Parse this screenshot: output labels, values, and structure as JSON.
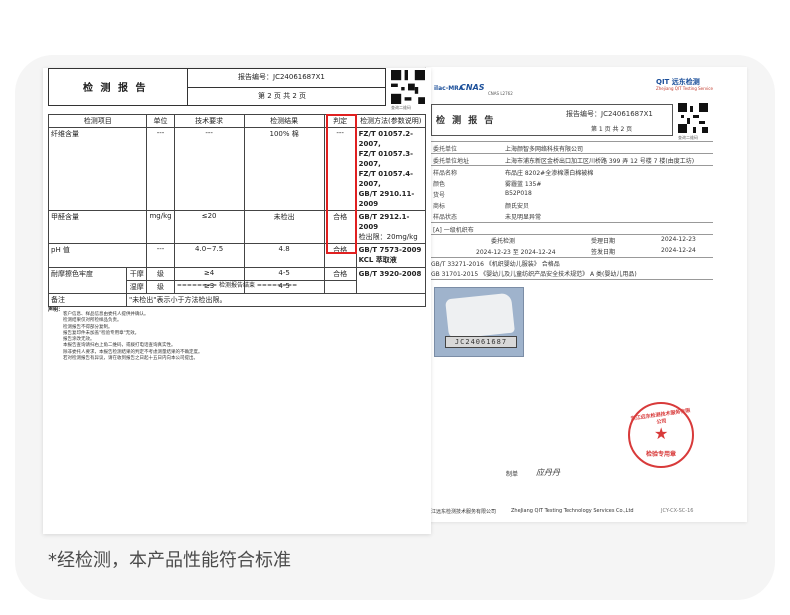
{
  "back": {
    "logo_ilac": "ilac-MRA",
    "logo_cnas": "CNAS",
    "cnas_number": "CNAS L2762",
    "brand": "QIT 远东检测",
    "brand_sub": "Zhejiang QIT Testing Service",
    "title": "检 测 报 告",
    "report_no": "报告编号：JC24061687X1",
    "page": "第 1 页 共 2 页",
    "qr_caption": "查询二维码",
    "rows": [
      {
        "label": "委托单位",
        "value": "上海颜智多网络科技有限公司"
      },
      {
        "label": "委托单位地址",
        "value": "上海市浦东新区金桥出口加工区川桥路 399 弄 12 号楼 7 楼(由度工坊)"
      },
      {
        "label": "样品名称",
        "value": "布品庄 8202#全渗棉漂白棉被棉"
      },
      {
        "label": "颜色",
        "value": "雾霾蓝 135#"
      },
      {
        "label": "货号",
        "value": "B52P018"
      },
      {
        "label": "商标",
        "value": "颜氏安贝"
      },
      {
        "label": "样品状态",
        "value": "未见明显异常"
      }
    ],
    "category": "[A] 一级机织布",
    "date_head_left": "委托检测",
    "date_head_mid": "受理日期",
    "date_head_right": "2024-12-23",
    "date_range": "2024-12-23 至 2024-12-24",
    "date_done_label": "签发日期",
    "date_done": "2024-12-24",
    "standards": [
      "GB/T 33271-2016 《机织婴幼儿服装》 合格品",
      "GB 31701-2015 《婴幼儿及儿童纺织产品安全技术规范》 A 类(婴幼儿用品)"
    ],
    "sample_tag": "JC24061687",
    "stamp_top": "浙江远东检测技术服务有限公司",
    "stamp_bottom": "检验专用章",
    "sign_label": "制单",
    "sign_name": "应丹丹",
    "footer_cn": "浙江远东检测技术服务有限公司",
    "footer_en": "ZheJiang QIT Testing Technology Services Co.,Ltd",
    "footer_tail": "JCY-CX-SC-16"
  },
  "front": {
    "title": "检 测 报 告",
    "report_no": "报告编号：JC24061687X1",
    "page": "第 2 页 共 2 页",
    "qr_caption": "查询二维码",
    "headers": [
      "检测项目",
      "单位",
      "技术要求",
      "检测结果",
      "判定",
      "检测方法(参数说明)"
    ],
    "rows": [
      {
        "item": "纤维含量",
        "unit": "---",
        "req": "---",
        "result": "100% 棉",
        "judge": "---",
        "method": [
          "FZ/T 01057.2-2007,",
          "FZ/T 01057.3-2007,",
          "FZ/T 01057.4-2007,",
          "GB/T 2910.11-2009"
        ]
      },
      {
        "item": "甲醛含量",
        "unit": "mg/kg",
        "req": "≤20",
        "result": "未检出",
        "judge": "合格",
        "method": [
          "GB/T 2912.1-2009",
          "检出限：20mg/kg"
        ]
      },
      {
        "item": "pH 值",
        "unit": "---",
        "req": "4.0~7.5",
        "result": "4.8",
        "judge": "合格",
        "method": [
          "GB/T 7573-2009",
          "KCL 萃取液"
        ]
      }
    ],
    "color_item": "耐摩擦色牢度",
    "color_rows": [
      {
        "sub": "干摩",
        "unit": "级",
        "req": "≥4",
        "result": "4-5",
        "judge": "合格",
        "method": "GB/T 3920-2008"
      },
      {
        "sub": "湿摩",
        "unit": "级",
        "req": "≥3",
        "result": "4-5"
      }
    ],
    "note_label": "备注",
    "note_text": "\"未检出\"表示小于方法检出限。",
    "end_text": "======== 检测报告结束 ========",
    "decl_title": "声明：",
    "decl_lines": [
      "客户信息、样品信息由委托人提供并确认。",
      "检测结果仅对所检样品负责。",
      "检测报告不得部分复制。",
      "报告复印件未加盖\"检验专用章\"无效。",
      "报告涂改无效。",
      "本报告查询请扫右上角二维码，或拨打电话查询真实性。",
      "除非委托人要求，本报告检测结果的判定不考虑测量结果的不确定度。",
      "若对检测报告有异议，请在收到报告之日起十五日内向本公司提出。"
    ]
  },
  "caption": "*经检测，本产品性能符合标准"
}
